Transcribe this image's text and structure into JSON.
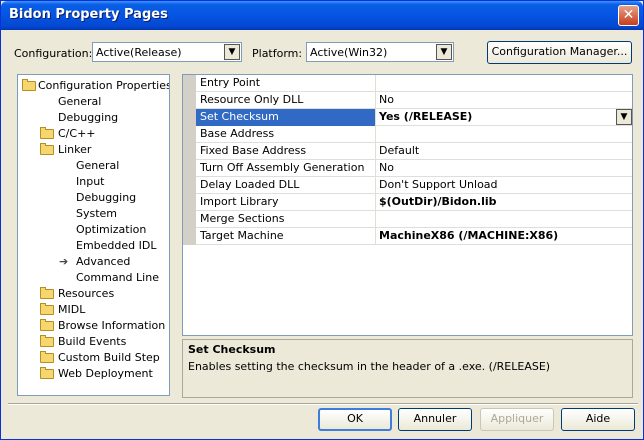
{
  "window": {
    "title": "Bidon Property Pages",
    "close_glyph": "✕"
  },
  "top": {
    "configuration_label": "Configuration:",
    "configuration_value": "Active(Release)",
    "platform_label": "Platform:",
    "platform_value": "Active(Win32)",
    "config_manager_label": "Configuration Manager..."
  },
  "tree": [
    {
      "label": "Configuration Properties",
      "folder": true
    },
    {
      "label": "General",
      "folder": false
    },
    {
      "label": "Debugging",
      "folder": false
    },
    {
      "label": "C/C++",
      "folder": true
    },
    {
      "label": "Linker",
      "folder": true
    },
    {
      "label": "General",
      "folder": false
    },
    {
      "label": "Input",
      "folder": false
    },
    {
      "label": "Debugging",
      "folder": false
    },
    {
      "label": "System",
      "folder": false
    },
    {
      "label": "Optimization",
      "folder": false
    },
    {
      "label": "Embedded IDL",
      "folder": false
    },
    {
      "label": "Advanced",
      "folder": false,
      "current": true
    },
    {
      "label": "Command Line",
      "folder": false
    },
    {
      "label": "Resources",
      "folder": true
    },
    {
      "label": "MIDL",
      "folder": true
    },
    {
      "label": "Browse Information",
      "folder": true
    },
    {
      "label": "Build Events",
      "folder": true
    },
    {
      "label": "Custom Build Step",
      "folder": true
    },
    {
      "label": "Web Deployment",
      "folder": true
    }
  ],
  "properties": [
    {
      "name": "Entry Point",
      "value": ""
    },
    {
      "name": "Resource Only DLL",
      "value": "No"
    },
    {
      "name": "Set Checksum",
      "value": "Yes (/RELEASE)",
      "bold": true,
      "selected": true
    },
    {
      "name": "Base Address",
      "value": ""
    },
    {
      "name": "Fixed Base Address",
      "value": "Default"
    },
    {
      "name": "Turn Off Assembly Generation",
      "value": "No"
    },
    {
      "name": "Delay Loaded DLL",
      "value": "Don't Support Unload"
    },
    {
      "name": "Import Library",
      "value": "$(OutDir)/Bidon.lib",
      "bold": true
    },
    {
      "name": "Merge Sections",
      "value": ""
    },
    {
      "name": "Target Machine",
      "value": "MachineX86 (/MACHINE:X86)",
      "bold": true
    }
  ],
  "description": {
    "title": "Set Checksum",
    "text": "Enables setting the checksum in the header of a .exe.    (/RELEASE)"
  },
  "buttons": {
    "ok": "OK",
    "cancel": "Annuler",
    "apply": "Appliquer",
    "help": "Aide"
  }
}
